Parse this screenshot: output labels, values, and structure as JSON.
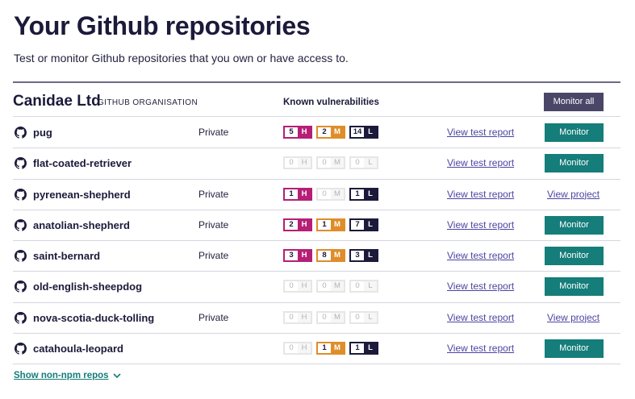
{
  "page": {
    "title": "Your Github repositories",
    "subtitle": "Test or monitor Github repositories that you own or have access to."
  },
  "org": {
    "name": "Canidae Ltd",
    "type": "GITHUB ORGANISATION",
    "vuln_heading": "Known vulnerabilities",
    "monitor_all_label": "Monitor all"
  },
  "colors": {
    "high": "#b51f76",
    "medium": "#df8d2a",
    "low": "#1b1a3a",
    "monitor_button": "#157d7a",
    "monitor_all_button": "#4a4668",
    "link": "#4b45a1"
  },
  "labels": {
    "severity_high": "H",
    "severity_medium": "M",
    "severity_low": "L",
    "view_test_report": "View test report",
    "view_project": "View project",
    "monitor": "Monitor"
  },
  "repos": [
    {
      "name": "pug",
      "visibility": "Private",
      "high": 5,
      "medium": 2,
      "low": 14,
      "action": "monitor"
    },
    {
      "name": "flat-coated-retriever",
      "visibility": "",
      "high": 0,
      "medium": 0,
      "low": 0,
      "action": "monitor"
    },
    {
      "name": "pyrenean-shepherd",
      "visibility": "Private",
      "high": 1,
      "medium": 0,
      "low": 1,
      "action": "view_project"
    },
    {
      "name": "anatolian-shepherd",
      "visibility": "Private",
      "high": 2,
      "medium": 1,
      "low": 7,
      "action": "monitor"
    },
    {
      "name": "saint-bernard",
      "visibility": "Private",
      "high": 3,
      "medium": 8,
      "low": 3,
      "action": "monitor"
    },
    {
      "name": "old-english-sheepdog",
      "visibility": "",
      "high": 0,
      "medium": 0,
      "low": 0,
      "action": "monitor"
    },
    {
      "name": "nova-scotia-duck-tolling",
      "visibility": "Private",
      "high": 0,
      "medium": 0,
      "low": 0,
      "action": "view_project"
    },
    {
      "name": "catahoula-leopard",
      "visibility": "",
      "high": 0,
      "medium": 1,
      "low": 1,
      "action": "monitor"
    }
  ],
  "footer": {
    "show_more_label": "Show non-npm repos",
    "show_more_icon": "chevron-down-icon"
  }
}
